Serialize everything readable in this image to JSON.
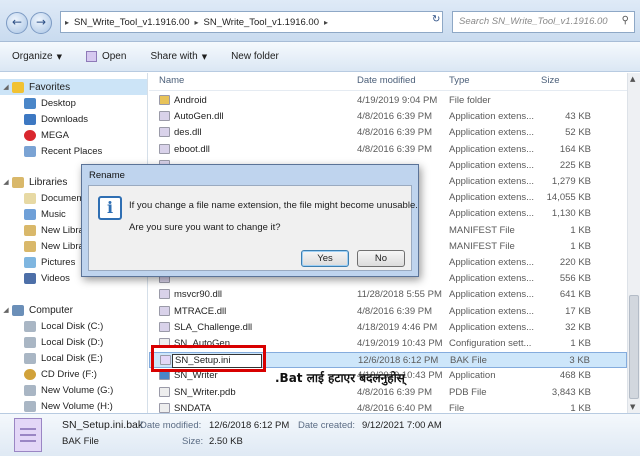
{
  "address": {
    "crumbs": [
      "SN_Write_Tool_v1.1916.00",
      "SN_Write_Tool_v1.1916.00"
    ],
    "search_placeholder": "Search SN_Write_Tool_v1.1916.00"
  },
  "toolbar": {
    "organize": "Organize",
    "open": "Open",
    "share_with": "Share with",
    "new_folder": "New folder"
  },
  "nav": {
    "favorites": "Favorites",
    "desktop": "Desktop",
    "downloads": "Downloads",
    "mega": "MEGA",
    "recent": "Recent Places",
    "libraries": "Libraries",
    "documents": "Documen",
    "music": "Music",
    "newlib1": "New Libra",
    "newlib2": "New Libra",
    "pictures": "Pictures",
    "videos": "Videos",
    "computer": "Computer",
    "drives": [
      "Local Disk (C:)",
      "Local Disk (D:)",
      "Local Disk (E:)",
      "CD Drive (F:)",
      "New Volume (G:)",
      "New Volume (H:)"
    ]
  },
  "columns": {
    "name": "Name",
    "date": "Date modified",
    "type": "Type",
    "size": "Size"
  },
  "files": [
    {
      "name": "Android",
      "date": "4/19/2019 9:04 PM",
      "type": "File folder",
      "size": ""
    },
    {
      "name": "AutoGen.dll",
      "date": "4/8/2016 6:39 PM",
      "type": "Application extens...",
      "size": "43 KB"
    },
    {
      "name": "des.dll",
      "date": "4/8/2016 6:39 PM",
      "type": "Application extens...",
      "size": "52 KB"
    },
    {
      "name": "eboot.dll",
      "date": "4/8/2016 6:39 PM",
      "type": "Application extens...",
      "size": "164 KB"
    },
    {
      "name": "",
      "date": "",
      "type": "Application extens...",
      "size": "225 KB"
    },
    {
      "name": "",
      "date": "",
      "type": "Application extens...",
      "size": "1,279 KB"
    },
    {
      "name": "",
      "date": "",
      "type": "Application extens...",
      "size": "14,055 KB"
    },
    {
      "name": "",
      "date": "",
      "type": "Application extens...",
      "size": "1,130 KB"
    },
    {
      "name": "",
      "date": "",
      "type": "MANIFEST File",
      "size": "1 KB"
    },
    {
      "name": "",
      "date": "",
      "type": "MANIFEST File",
      "size": "1 KB"
    },
    {
      "name": "",
      "date": "",
      "type": "Application extens...",
      "size": "220 KB"
    },
    {
      "name": "",
      "date": "",
      "type": "Application extens...",
      "size": "556 KB"
    },
    {
      "name": "msvcr90.dll",
      "date": "11/28/2018 5:55 PM",
      "type": "Application extens...",
      "size": "641 KB"
    },
    {
      "name": "MTRACE.dll",
      "date": "4/8/2016 6:39 PM",
      "type": "Application extens...",
      "size": "17 KB"
    },
    {
      "name": "SLA_Challenge.dll",
      "date": "4/18/2019 4:46 PM",
      "type": "Application extens...",
      "size": "32 KB"
    },
    {
      "name": "SN_AutoGen",
      "date": "4/19/2019 10:43 PM",
      "type": "Configuration sett...",
      "size": "1 KB"
    },
    {
      "name": "SN_Setup.ini",
      "date": "12/6/2018 6:12 PM",
      "type": "BAK File",
      "size": "3 KB"
    },
    {
      "name": "SN_Writer",
      "date": "4/19/2019 10:43 PM",
      "type": "Application",
      "size": "468 KB"
    },
    {
      "name": "SN_Writer.pdb",
      "date": "4/8/2016 6:39 PM",
      "type": "PDB File",
      "size": "3,843 KB"
    },
    {
      "name": "SNDATA",
      "date": "4/8/2016 6:40 PM",
      "type": "File",
      "size": "1 KB"
    }
  ],
  "annotation": ".Bat लाई हटाएर बदलनुहोस्",
  "details": {
    "filename": "SN_Setup.ini.bak",
    "filetype": "BAK File",
    "date_modified_label": "Date modified:",
    "date_modified": "12/6/2018 6:12 PM",
    "date_created_label": "Date created:",
    "date_created": "9/12/2021 7:00 AM",
    "size_label": "Size:",
    "size": "2.50 KB"
  },
  "dialog": {
    "title": "Rename",
    "line1": "If you change a file name extension, the file might become unusable.",
    "line2": "Are you sure you want to change it?",
    "yes": "Yes",
    "no": "No"
  },
  "colors": {
    "selection": "#cde6fa",
    "highlight_box": "#d80000",
    "dialog_frame": "#bfd4ee"
  }
}
